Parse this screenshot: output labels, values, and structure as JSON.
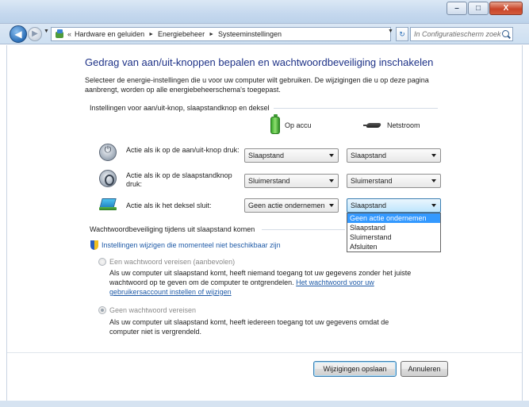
{
  "window": {
    "minimize_glyph": "–",
    "maximize_glyph": "□",
    "close_glyph": "X"
  },
  "nav": {
    "back_glyph": "◀",
    "forward_glyph": "▶",
    "dropdown_glyph": "▼",
    "breadcrumb_overflow": "«",
    "breadcrumb_separator": "►",
    "breadcrumbs": [
      "Hardware en geluiden",
      "Energiebeheer",
      "Systeeminstellingen"
    ],
    "refresh_glyph": "↻",
    "search_placeholder": "In Configuratiescherm zoeken"
  },
  "main": {
    "title": "Gedrag van aan/uit-knoppen bepalen en wachtwoordbeveiliging inschakelen",
    "description": "Selecteer de energie-instellingen die u voor uw computer wilt gebruiken. De wijzigingen die u op deze pagina aanbrengt, worden op alle energiebeheerschema's toegepast."
  },
  "buttons_section": {
    "heading": "Instellingen voor aan/uit-knop, slaapstandknop en deksel",
    "col_battery": "Op accu",
    "col_power": "Netstroom",
    "rows": [
      {
        "label": "Actie als ik op de aan/uit-knop druk:",
        "battery": "Slaapstand",
        "power": "Slaapstand"
      },
      {
        "label": "Actie als ik op de slaapstandknop druk:",
        "battery": "Sluimerstand",
        "power": "Sluimerstand"
      },
      {
        "label": "Actie als ik het deksel sluit:",
        "battery": "Geen actie ondernemen",
        "power": "Slaapstand"
      }
    ],
    "dropdown_options": [
      "Geen actie ondernemen",
      "Slaapstand",
      "Sluimerstand",
      "Afsluiten"
    ],
    "dropdown_highlighted": "Geen actie ondernemen"
  },
  "password_section": {
    "heading": "Wachtwoordbeveiliging tijdens uit slaapstand komen",
    "change_link": "Instellingen wijzigen die momenteel niet beschikbaar zijn",
    "option1_label": "Een wachtwoord vereisen (aanbevolen)",
    "option1_desc": "Als uw computer uit slaapstand komt, heeft niemand toegang tot uw gegevens zonder het juiste wachtwoord op te geven om de computer te ontgrendelen.",
    "option1_link": "Het wachtwoord voor uw gebruikersaccount instellen of wijzigen",
    "option2_label": "Geen wachtwoord vereisen",
    "option2_desc": "Als uw computer uit slaapstand komt, heeft iedereen toegang tot uw gegevens omdat de computer niet is vergrendeld.",
    "selected_option": "Geen wachtwoord vereisen"
  },
  "footer": {
    "save_label": "Wijzigingen opslaan",
    "cancel_label": "Annuleren"
  }
}
